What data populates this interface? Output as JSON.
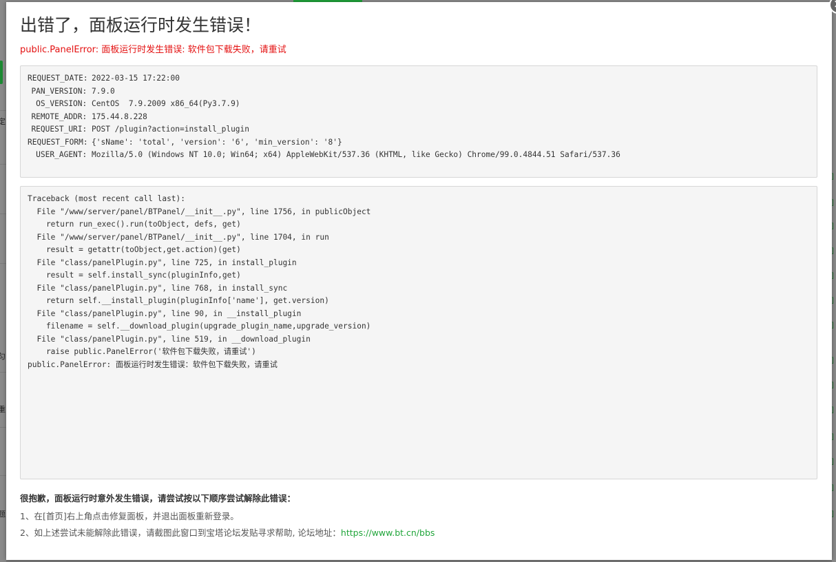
{
  "dialog": {
    "title": "出错了，面板运行时发生错误！",
    "subtitle": "public.PanelError: 面板运行时发生错误: 软件包下载失败，请重试",
    "close_label": "×"
  },
  "request_info": [
    {
      "key": "REQUEST_DATE: ",
      "value": "2022-03-15 17:22:00"
    },
    {
      "key": "PAN_VERSION: ",
      "value": "7.9.0"
    },
    {
      "key": "OS_VERSION: ",
      "value": "CentOS  7.9.2009 x86_64(Py3.7.9)"
    },
    {
      "key": "REMOTE_ADDR: ",
      "value": "175.44.8.228"
    },
    {
      "key": "REQUEST_URI: ",
      "value": "POST /plugin?action=install_plugin"
    },
    {
      "key": "REQUEST_FORM: ",
      "value": "{'sName': 'total', 'version': '6', 'min_version': '8'}"
    },
    {
      "key": "USER_AGENT: ",
      "value": "Mozilla/5.0 (Windows NT 10.0; Win64; x64) AppleWebKit/537.36 (KHTML, like Gecko) Chrome/99.0.4844.51 Safari/537.36"
    }
  ],
  "traceback": [
    "Traceback (most recent call last):",
    "  File \"/www/server/panel/BTPanel/__init__.py\", line 1756, in publicObject",
    "    return run_exec().run(toObject, defs, get)",
    "  File \"/www/server/panel/BTPanel/__init__.py\", line 1704, in run",
    "    result = getattr(toObject,get.action)(get)",
    "  File \"class/panelPlugin.py\", line 725, in install_plugin",
    "    result = self.install_sync(pluginInfo,get)",
    "  File \"class/panelPlugin.py\", line 768, in install_sync",
    "    return self.__install_plugin(pluginInfo['name'], get.version)",
    "  File \"class/panelPlugin.py\", line 90, in __install_plugin",
    "    filename = self.__download_plugin(upgrade_plugin_name,upgrade_version)",
    "  File \"class/panelPlugin.py\", line 519, in __download_plugin",
    "    raise public.PanelError('软件包下载失败，请重试')",
    "public.PanelError: 面板运行时发生错误：软件包下载失败，请重试"
  ],
  "help": {
    "title": "很抱歉，面板运行时意外发生错误，请尝试按以下顺序尝试解除此错误：",
    "step1": "1、在[首页]右上角点击修复面板，并退出面板重新登录。",
    "step2_prefix": "2、如上述尝试未能解除此错误，请截图此窗口到宝塔论坛发贴寻求帮助, 论坛地址：",
    "forum_link": "https://www.bt.cn/bbs"
  },
  "colors": {
    "accent": "#20a53a",
    "error_text": "#e41111"
  },
  "background_page": {
    "left_edge_chars": [
      "定",
      "t",
      "t",
      "匀",
      "重",
      "题"
    ]
  }
}
